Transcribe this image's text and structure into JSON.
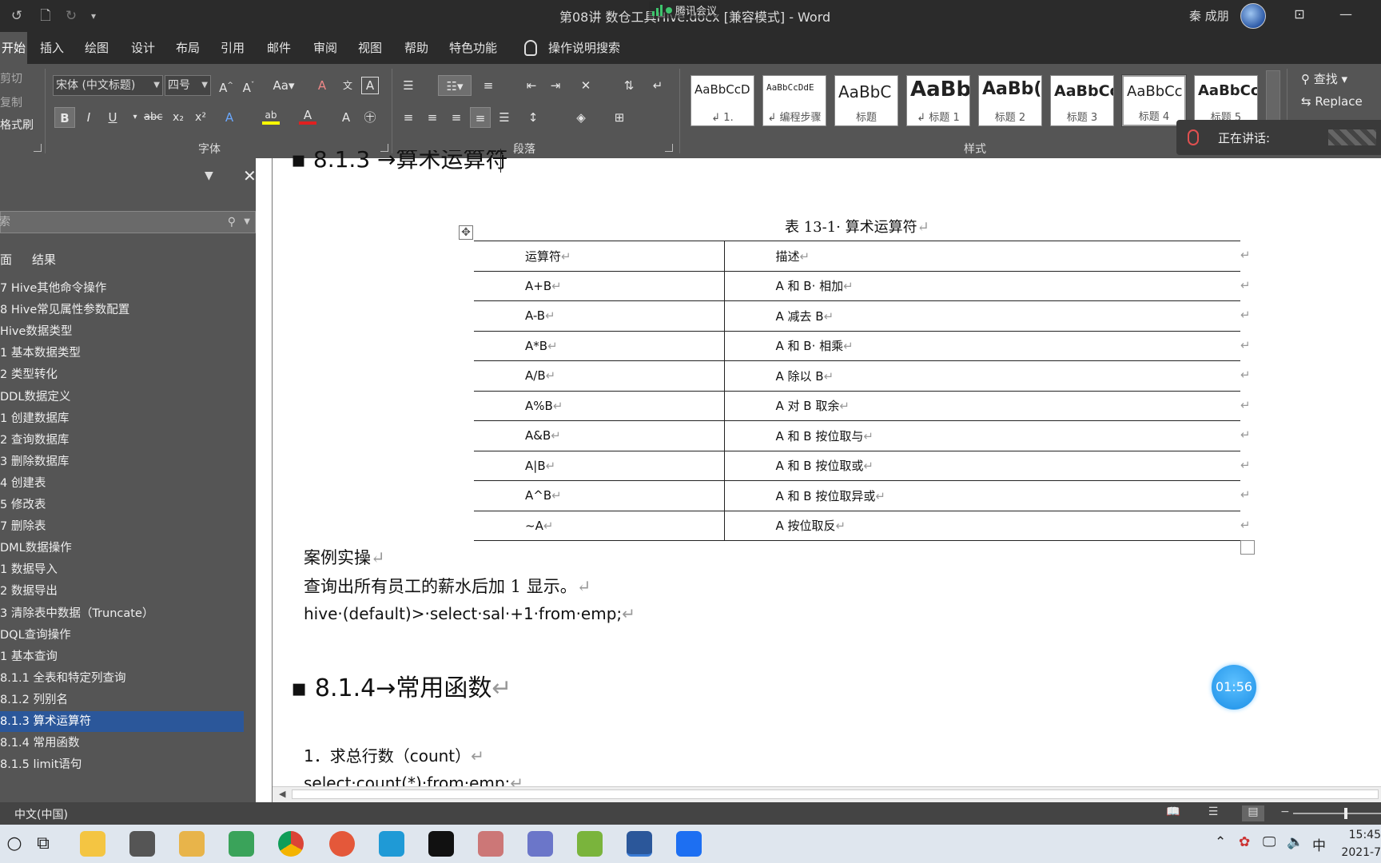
{
  "window": {
    "title": "第08讲 数仓工具Hive.docx [兼容模式]  -  Word",
    "meeting_label": "腾讯会议",
    "user_name": "秦 成朋"
  },
  "ribbon_tabs": [
    "开始",
    "插入",
    "绘图",
    "设计",
    "布局",
    "引用",
    "邮件",
    "审阅",
    "视图",
    "帮助",
    "特色功能"
  ],
  "tell_me": "操作说明搜索",
  "clipboard": {
    "cut": "剪切",
    "copy": "复制",
    "format_painter": "格式刷"
  },
  "font": {
    "name": "宋体 (中文标题)",
    "size": "四号",
    "group_label": "字体"
  },
  "paragraph": {
    "group_label": "段落"
  },
  "styles": {
    "group_label": "样式",
    "cards": [
      {
        "sample": "AaBbCcD",
        "name": "↲ 1."
      },
      {
        "sample": "AaBbCcDdE",
        "name": "↲ 编程步骤"
      },
      {
        "sample": "AaBbC",
        "name": "标题"
      },
      {
        "sample": "AaBb",
        "name": "↲ 标题 1"
      },
      {
        "sample": "AaBb(",
        "name": "标题 2"
      },
      {
        "sample": "AaBbCc",
        "name": "标题 3"
      },
      {
        "sample": "AaBbCc",
        "name": "标题 4"
      },
      {
        "sample": "AaBbCcI",
        "name": "标题 5"
      }
    ],
    "selected_index": 6
  },
  "editing": {
    "find": "查找",
    "replace": "Replace"
  },
  "speaking": {
    "label": "正在讲话:"
  },
  "nav": {
    "search_placeholder": "索",
    "tabs": [
      "面",
      "结果"
    ],
    "items": [
      "7 Hive其他命令操作",
      "8 Hive常见属性参数配置",
      "Hive数据类型",
      "1 基本数据类型",
      "2 类型转化",
      "DDL数据定义",
      "1 创建数据库",
      "2 查询数据库",
      "3 删除数据库",
      "4 创建表",
      "5 修改表",
      "7 删除表",
      "DML数据操作",
      "1 数据导入",
      "2 数据导出",
      "3 清除表中数据（Truncate）",
      "DQL查询操作",
      "1 基本查询",
      "  8.1.1 全表和特定列查询",
      "  8.1.2 列别名",
      "  8.1.3 算术运算符",
      "  8.1.4 常用函数",
      "  8.1.5 limit语句"
    ],
    "selected_index": 20
  },
  "document": {
    "top_heading": "8.1.3 →算术运算符",
    "table_caption": "表 13-1· 算术运算符",
    "table_header": [
      "运算符",
      "描述"
    ],
    "table_rows": [
      [
        "A+B",
        "A 和 B· 相加"
      ],
      [
        "A-B",
        "A 减去 B"
      ],
      [
        "A*B",
        "A 和 B· 相乘"
      ],
      [
        "A/B",
        "A 除以 B"
      ],
      [
        "A%B",
        "A 对 B 取余"
      ],
      [
        "A&B",
        "A 和 B 按位取与"
      ],
      [
        "A|B",
        "A 和 B 按位取或"
      ],
      [
        "A^B",
        "A 和 B 按位取异或"
      ],
      [
        "~A",
        "A 按位取反"
      ]
    ],
    "case_title": "案例实操",
    "case_desc": "查询出所有员工的薪水后加 1 显示。",
    "case_sql": "hive·(default)>·select·sal·+1·from·emp;",
    "heading_814": "8.1.4→常用函数",
    "item1": "1．求总行数（count）",
    "item1_sql": "select·count(*)·from·emp;"
  },
  "timer": "01:56",
  "status": {
    "language": "中文(中国)"
  },
  "taskbar": {
    "ime": "中",
    "time": "15:45",
    "date": "2021-7"
  },
  "colors": {
    "ribbon": "#555555",
    "selection": "#2b579a",
    "timer": "#1a8ee6"
  }
}
